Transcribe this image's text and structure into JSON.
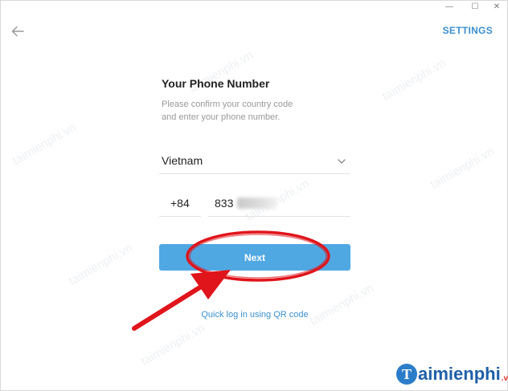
{
  "window": {
    "controls": {
      "minimize": "—",
      "maximize": "☐",
      "close": "✕"
    }
  },
  "header": {
    "back_icon": "arrow-left-icon",
    "settings_label": "SETTINGS"
  },
  "form": {
    "title": "Your Phone Number",
    "description_line1": "Please confirm your country code",
    "description_line2": "and enter your phone number.",
    "country": "Vietnam",
    "country_code": "+84",
    "phone_prefix": "833",
    "next_label": "Next",
    "qr_link": "Quick log in using QR code"
  },
  "annotation": {
    "color": "#e0141b"
  },
  "watermark": {
    "text": "taimienphi.vn"
  },
  "brand": {
    "initial": "T",
    "name": "aimienphi",
    "suffix": ".vn"
  },
  "colors": {
    "accent": "#3b8fd0",
    "button": "#50a8e3"
  }
}
